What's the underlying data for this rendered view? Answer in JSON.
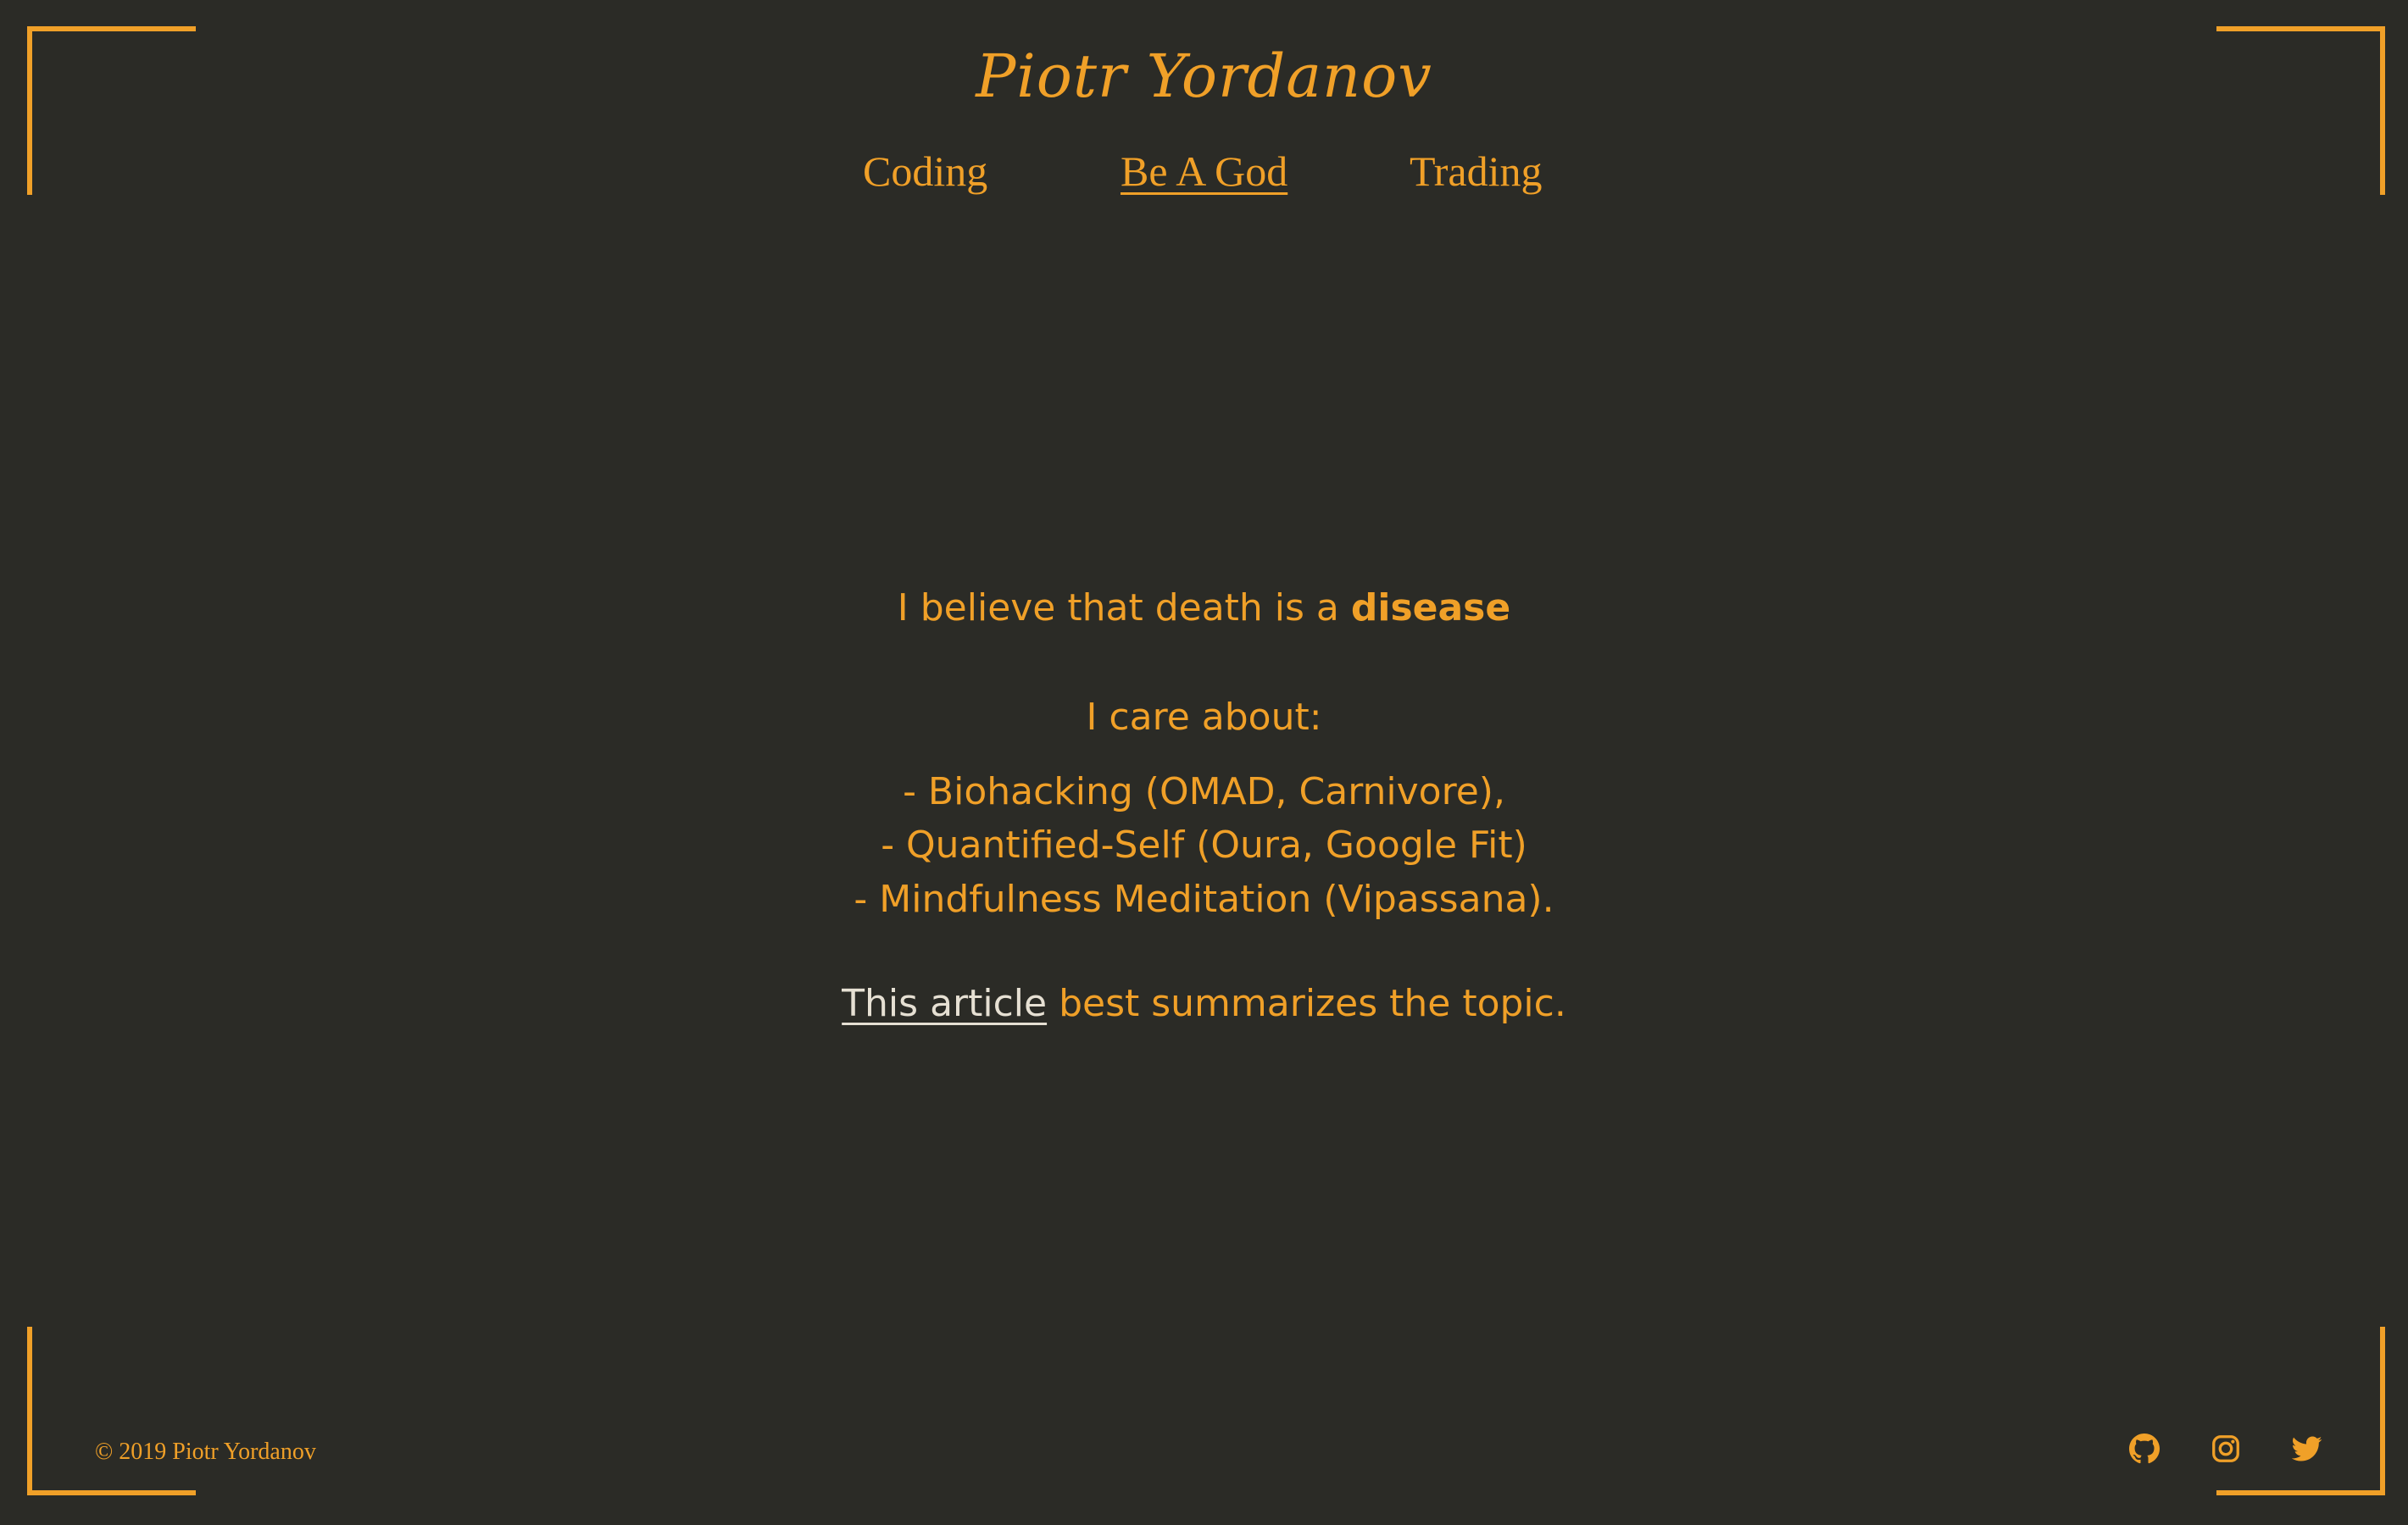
{
  "header": {
    "brand": "Piotr Yordanov",
    "nav": [
      {
        "label": "Coding"
      },
      {
        "label": "Be A God"
      },
      {
        "label": "Trading"
      }
    ]
  },
  "main": {
    "statement_prefix": "I believe that death is a ",
    "statement_emphasis": "disease",
    "care_heading": "I care about:",
    "items": [
      "- Biohacking (OMAD, Carnivore),",
      "- Quantified-Self (Oura, Google Fit)",
      "- Mindfulness Meditation (Vipassana)."
    ],
    "article_link": "This article",
    "article_suffix": " best summarizes the topic."
  },
  "footer": {
    "copyright": "© 2019 Piotr Yordanov",
    "social": [
      {
        "icon": "github-icon"
      },
      {
        "icon": "instagram-icon"
      },
      {
        "icon": "twitter-icon"
      }
    ]
  },
  "colors": {
    "background": "#2b2b26",
    "accent": "#f0a028",
    "link": "#e6e0d3"
  }
}
